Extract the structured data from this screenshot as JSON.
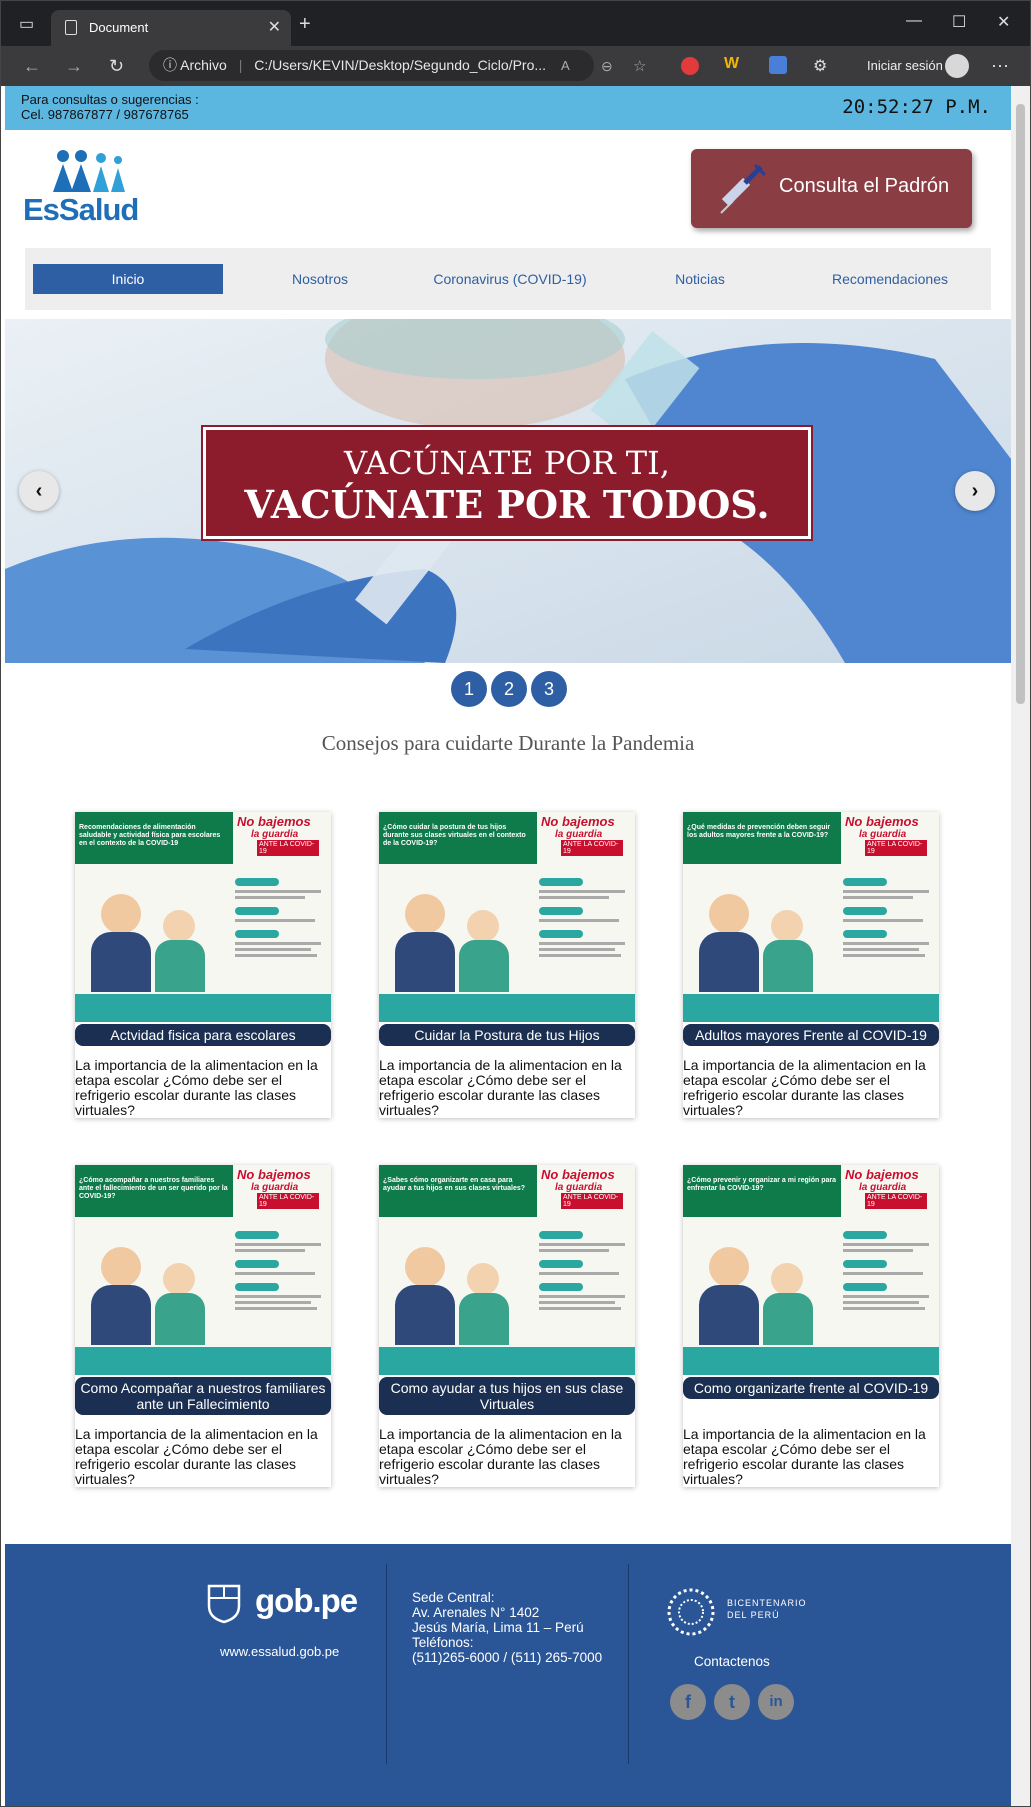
{
  "browser": {
    "tab_title": "Document",
    "address_label": "Archivo",
    "address_url": "C:/Users/KEVIN/Desktop/Segundo_Ciclo/Pro...",
    "signin_label": "Iniciar sesión"
  },
  "topbar": {
    "line1": "Para consultas o sugerencias :",
    "line2": "Cel. 987867877 / 987678765",
    "clock": "20:52:27 P.M."
  },
  "header": {
    "logo_text": "EsSalud",
    "padron_button": "Consulta el Padrón"
  },
  "nav": {
    "items": [
      {
        "label": "Inicio",
        "active": true
      },
      {
        "label": "Nosotros"
      },
      {
        "label": "Coronavirus (COVID-19)"
      },
      {
        "label": "Noticias"
      },
      {
        "label": "Recomendaciones"
      }
    ]
  },
  "carousel": {
    "line1": "VACÚNATE POR TI,",
    "line2": "VACÚNATE POR TODOS.",
    "prev": "‹",
    "next": "›",
    "dots": [
      "1",
      "2",
      "3"
    ]
  },
  "section_title": "Consejos para cuidarte Durante la Pandemia",
  "cards": [
    {
      "title": "Actvidad fisica para escolares",
      "desc": "La importancia de la alimentacion en la etapa escolar ¿Cómo debe ser el refrigerio escolar durante las clases virtuales?",
      "img_caption": "Recomendaciones de alimentación saludable y actividad física para escolares en el contexto de la COVID-19",
      "color": "#0f7a4a"
    },
    {
      "title": "Cuidar la Postura de tus Hijos",
      "desc": "La importancia de la alimentacion en la etapa escolar ¿Cómo debe ser el refrigerio escolar durante las clases virtuales?",
      "img_caption": "¿Cómo cuidar la postura de tus hijos durante sus clases virtuales en el contexto de la COVID-19?",
      "color": "#0f7a4a"
    },
    {
      "title": "Adultos mayores Frente al COVID-19",
      "desc": "La importancia de la alimentacion en la etapa escolar ¿Cómo debe ser el refrigerio escolar durante las clases virtuales?",
      "img_caption": "¿Qué medidas de prevención deben seguir los adultos mayores frente a la COVID-19?",
      "color": "#0f7a4a"
    },
    {
      "title": "Como Acompañar a nuestros familiares ante un Fallecimiento",
      "desc": "La importancia de la alimentacion en la etapa escolar ¿Cómo debe ser el refrigerio escolar durante las clases virtuales?",
      "img_caption": "¿Cómo acompañar a nuestros familiares ante el fallecimiento de un ser querido por la COVID-19?",
      "color": "#0f7a4a"
    },
    {
      "title": "Como ayudar a tus hijos en sus clase Virtuales",
      "desc": "La importancia de la alimentacion en la etapa escolar ¿Cómo debe ser el refrigerio escolar durante las clases virtuales?",
      "img_caption": "¿Sabes cómo organizarte en casa para ayudar a tus hijos en sus clases virtuales?",
      "color": "#0f7a4a"
    },
    {
      "title": "Como organizarte frente al COVID-19",
      "desc": "La importancia de la alimentacion en la etapa escolar ¿Cómo debe ser el refrigerio escolar durante las clases virtuales?",
      "img_caption": "¿Cómo prevenir y organizar a mi región para enfrentar la COVID-19?",
      "color": "#0f7a4a"
    }
  ],
  "badge": {
    "line1": "No bajemos",
    "line2": "la guardia",
    "line3": "ANTE LA COVID-19"
  },
  "footer": {
    "gob_text": "gob.pe",
    "gob_web": "www.essalud.gob.pe",
    "address": [
      "Sede Central:",
      "Av. Arenales N° 1402",
      "Jesús María, Lima 11 – Perú",
      "Teléfonos:",
      "(511)265-6000 / (511) 265-7000"
    ],
    "bicentenario": [
      "BICENTENARIO",
      "DEL PERÚ"
    ],
    "contact": "Contactenos",
    "social": [
      "f",
      "t",
      "in"
    ]
  }
}
